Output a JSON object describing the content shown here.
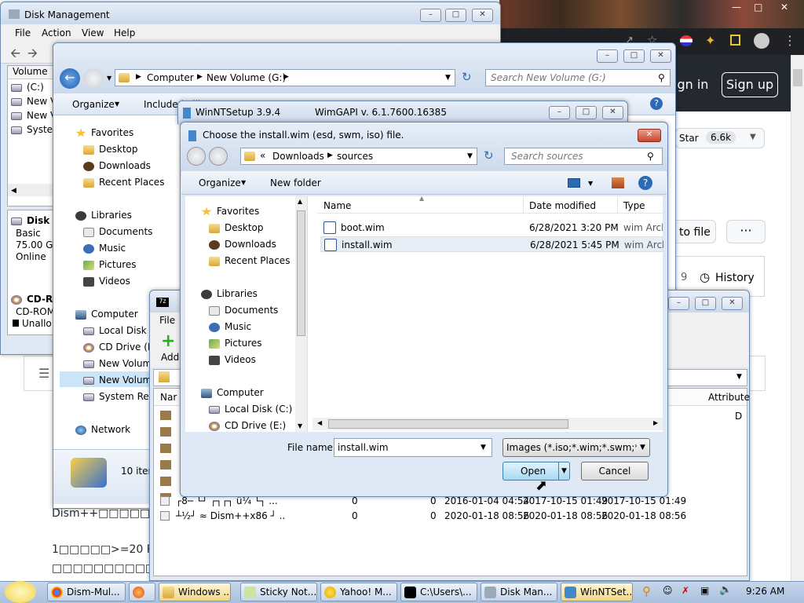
{
  "disk_mgmt": {
    "title": "Disk Management",
    "menu": [
      "File",
      "Action",
      "View",
      "Help"
    ],
    "col_volume": "Volume",
    "volumes": [
      "(C:)",
      "New Vo",
      "New Vo",
      "System"
    ],
    "disk0": {
      "name": "Disk 0",
      "type": "Basic",
      "size": "75.00 GB",
      "status": "Online"
    },
    "cdrom": {
      "name": "CD-R",
      "type": "CD-ROM",
      "unalloc": "Unallo"
    }
  },
  "explorer": {
    "address": [
      "Computer",
      "New Volume (G:)"
    ],
    "search_placeholder": "Search New Volume (G:)",
    "organize": "Organize",
    "include": "Include in library",
    "nav": {
      "favorites": "Favorites",
      "desktop": "Desktop",
      "downloads": "Downloads",
      "recent": "Recent Places",
      "libraries": "Libraries",
      "documents": "Documents",
      "music": "Music",
      "pictures": "Pictures",
      "videos": "Videos",
      "computer": "Computer",
      "localdisk": "Local Disk (C",
      "cddrive": "CD Drive (E:",
      "newvol1": "New Volum",
      "newvol2": "New Volum",
      "sysres": "System Rese",
      "network": "Network"
    },
    "items_count": "10 iter"
  },
  "winntsetup": {
    "title": "WinNTSetup 3.9.4",
    "subtitle": "WimGAPI v. 6.1.7600.16385"
  },
  "sevenzip": {
    "menu_file": "File",
    "add": "Add",
    "col_name": "Nar",
    "col_attr": "Attribute",
    "rows": [
      {
        "name": "┌8─ └┘ ┌┐┌┐ ü¼ └┐ ...",
        "size": "0",
        "packed": "0",
        "modified": "2016-01-04 04:54",
        "created": "2017-10-15 01:49",
        "accessed": "2017-10-15 01:49"
      },
      {
        "name": "┴½┘ ≈ Dism++x86 ┘ ...",
        "size": "0",
        "packed": "0",
        "modified": "2020-01-18 08:56",
        "created": "2020-01-18 08:56",
        "accessed": "2020-01-18 08:56"
      }
    ]
  },
  "dialog": {
    "title": "Choose the install.wim (esd, swm, iso) file.",
    "path": [
      "Downloads",
      "sources"
    ],
    "path_prefix": "«",
    "search_placeholder": "Search sources",
    "organize": "Organize",
    "new_folder": "New folder",
    "columns": {
      "name": "Name",
      "date": "Date modified",
      "type": "Type"
    },
    "files": [
      {
        "name": "boot.wim",
        "date": "6/28/2021 3:20 PM",
        "type": "wim Arch"
      },
      {
        "name": "install.wim",
        "date": "6/28/2021 5:45 PM",
        "type": "wim Arch"
      }
    ],
    "nav": {
      "favorites": "Favorites",
      "desktop": "Desktop",
      "downloads": "Downloads",
      "recent": "Recent Places",
      "libraries": "Libraries",
      "documents": "Documents",
      "music": "Music",
      "pictures": "Pictures",
      "videos": "Videos",
      "computer": "Computer",
      "localdisk": "Local Disk (C:)",
      "cddrive": "CD Drive (E:)"
    },
    "filename_label": "File name:",
    "filename_value": "install.wim",
    "filter": "Images (*.iso;*.wim;*.swm;*.esd",
    "open": "Open",
    "cancel": "Cancel"
  },
  "github": {
    "sign_in": "ign in",
    "sign_up": "Sign up",
    "star": "Star",
    "star_count": "6.6k",
    "to_file": "to file",
    "more": "···",
    "history_num": "9",
    "history": "History",
    "text1": "Dism++□□□□□□□□",
    "text2": "1□□□□□>=20 RM",
    "text3": "□□□□□□□□□□□□□"
  },
  "taskbar": {
    "tasks": [
      "Dism-Mul...",
      "",
      "Windows ...",
      "Sticky Not...",
      "Yahoo! M...",
      "C:\\Users\\...",
      "Disk Man...",
      "WinNTSet..."
    ],
    "clock": "9:26 AM"
  }
}
